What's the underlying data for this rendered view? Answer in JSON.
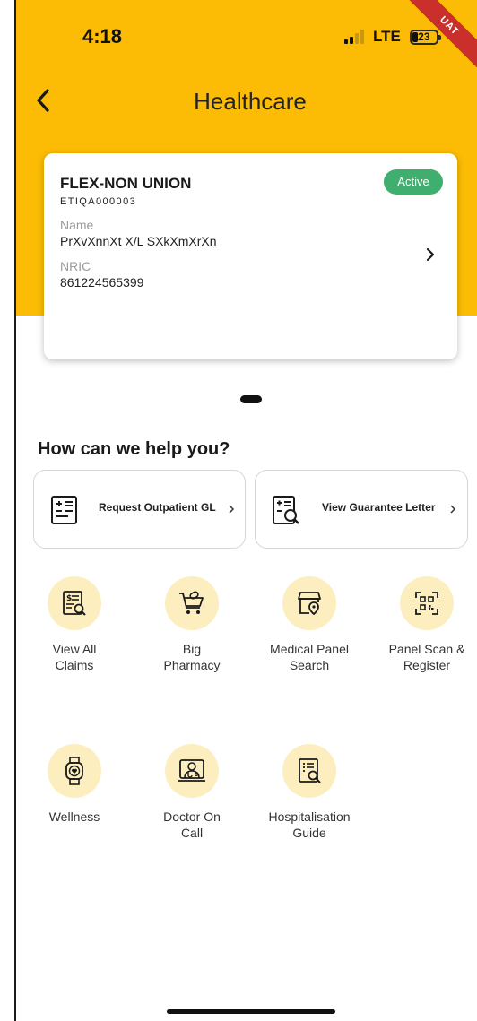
{
  "status_bar": {
    "time": "4:18",
    "network": "LTE",
    "battery": "23",
    "env_ribbon": "UAT"
  },
  "header": {
    "title": "Healthcare",
    "back_icon": "chevron-left-icon"
  },
  "policy_card": {
    "plan_name": "FLEX-NON UNION",
    "policy_code": "ETIQA000003",
    "name_label": "Name",
    "name_value": "PrXvXnnXt X/L SXkXmXrXn",
    "nric_label": "NRIC",
    "nric_value": "861224565399",
    "status": "Active",
    "status_color": "#3fae6e"
  },
  "help_section": {
    "heading": "How can we help you?"
  },
  "quick_actions": [
    {
      "label": "Request Outpatient GL",
      "icon": "request-document-icon"
    },
    {
      "label": "View Guarantee Letter",
      "icon": "document-search-icon"
    }
  ],
  "services": [
    {
      "label": "View All\nClaims",
      "icon": "claims-receipt-icon"
    },
    {
      "label": "Big\nPharmacy",
      "icon": "pharmacy-cart-icon"
    },
    {
      "label": "Medical Panel\nSearch",
      "icon": "clinic-location-icon"
    },
    {
      "label": "Panel Scan &\nRegister",
      "icon": "qr-scan-icon"
    },
    {
      "label": "Wellness",
      "icon": "smartwatch-heart-icon"
    },
    {
      "label": "Doctor On\nCall",
      "icon": "doctor-video-icon"
    },
    {
      "label": "Hospitalisation\nGuide",
      "icon": "guide-search-icon"
    }
  ],
  "colors": {
    "brand_yellow": "#fcbc05",
    "icon_circle": "#fdeec0"
  }
}
